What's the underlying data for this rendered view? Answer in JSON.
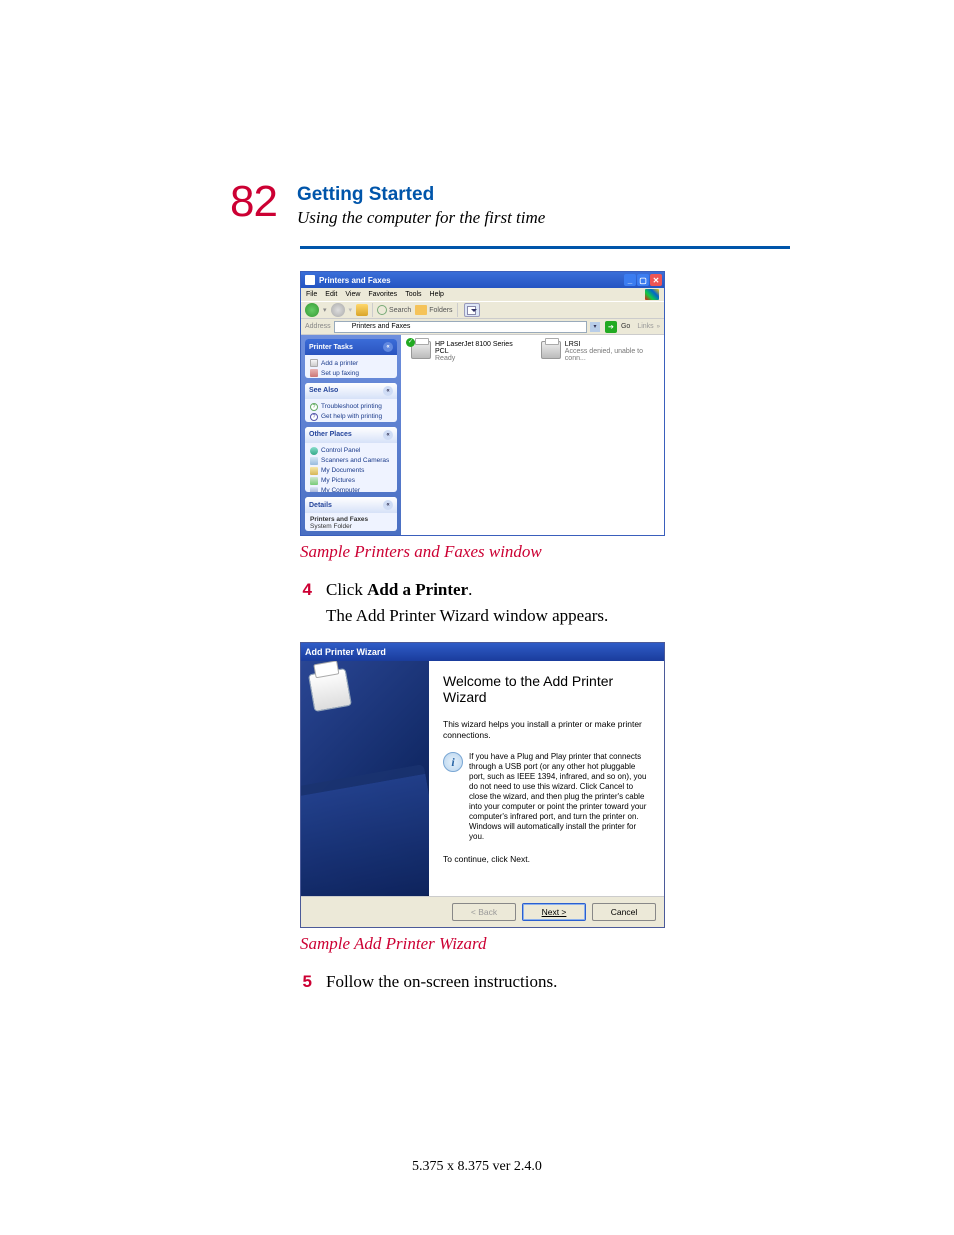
{
  "pageNumber": "82",
  "sectionTitle": "Getting Started",
  "subtitle": "Using the computer for the first time",
  "caption1": "Sample Printers and Faxes window",
  "step4_num": "4",
  "step4_text_pre": "Click ",
  "step4_text_bold": "Add a Printer",
  "step4_text_post": ".",
  "step4_followup": "The Add Printer Wizard window appears.",
  "caption2": "Sample Add Printer Wizard",
  "step5_num": "5",
  "step5_text": "Follow the on-screen instructions.",
  "footer": "5.375 x 8.375 ver 2.4.0",
  "pf": {
    "title": "Printers and Faxes",
    "menu": {
      "file": "File",
      "edit": "Edit",
      "view": "View",
      "favorites": "Favorites",
      "tools": "Tools",
      "help": "Help"
    },
    "toolbar": {
      "search": "Search",
      "folders": "Folders"
    },
    "addressLabel": "Address",
    "addressText": "Printers and Faxes",
    "go": "Go",
    "links": "Links",
    "panels": {
      "tasks": {
        "title": "Printer Tasks",
        "items": [
          "Add a printer",
          "Set up faxing"
        ]
      },
      "see": {
        "title": "See Also",
        "items": [
          "Troubleshoot printing",
          "Get help with printing"
        ]
      },
      "other": {
        "title": "Other Places",
        "items": [
          "Control Panel",
          "Scanners and Cameras",
          "My Documents",
          "My Pictures",
          "My Computer"
        ]
      },
      "details": {
        "title": "Details",
        "name": "Printers and Faxes",
        "type": "System Folder"
      }
    },
    "printers": [
      {
        "name": "HP LaserJet 8100 Series PCL",
        "status": "Ready",
        "default": true
      },
      {
        "name": "LRSI",
        "status": "Access denied, unable to conn...",
        "default": false
      }
    ]
  },
  "wizard": {
    "title": "Add Printer Wizard",
    "heading": "Welcome to the Add Printer Wizard",
    "intro": "This wizard helps you install a printer or make printer connections.",
    "info": "If you have a Plug and Play printer that connects through a USB port (or any other hot pluggable port, such as IEEE 1394, infrared, and so on), you do not need to use this wizard. Click Cancel to close the wizard, and then plug the printer's cable into your computer or point the printer toward your computer's infrared port, and turn the printer on. Windows will automatically install the printer for you.",
    "continue": "To continue, click Next.",
    "buttons": {
      "back": "< Back",
      "next": "Next >",
      "cancel": "Cancel"
    }
  }
}
